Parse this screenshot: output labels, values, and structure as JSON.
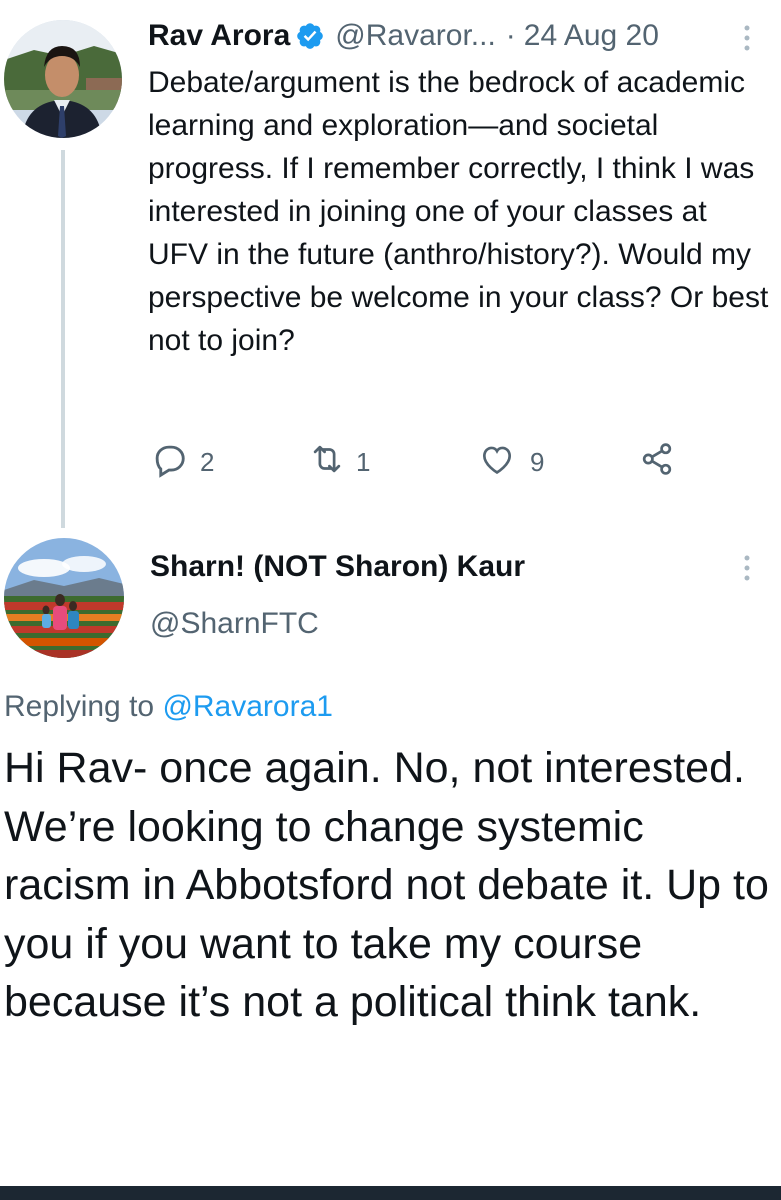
{
  "tweet1": {
    "author_name": "Rav Arora",
    "handle": "@Ravaror...",
    "separator": "·",
    "date": "24 Aug 20",
    "text": "Debate/argument is the bedrock of academic learning and exploration—and societal progress. If I remember correctly, I think I was interested in joining one of your classes at UFV in the future (anthro/history?). Would my perspective be welcome in your class? Or best not to join?",
    "actions": {
      "replies": "2",
      "retweets": "1",
      "likes": "9"
    },
    "verified_color": "#1d9bf0"
  },
  "tweet2": {
    "author_name": "Sharn! (NOT Sharon) Kaur",
    "handle": "@SharnFTC",
    "replying_prefix": "Replying to",
    "replying_handle": "@Ravarora1",
    "text": "Hi Rav- once again. No, not interested. We’re looking to change systemic racism in Abbotsford not debate it. Up to you if you want to take my course because it’s not a political think tank."
  },
  "colors": {
    "link": "#1d9bf0",
    "muted": "#536471",
    "thread_line": "#cfd9de",
    "bottom_bar": "#1c2732"
  },
  "icons": [
    "verified-badge-icon",
    "more-options-icon",
    "reply-icon",
    "retweet-icon",
    "like-icon",
    "share-icon"
  ]
}
